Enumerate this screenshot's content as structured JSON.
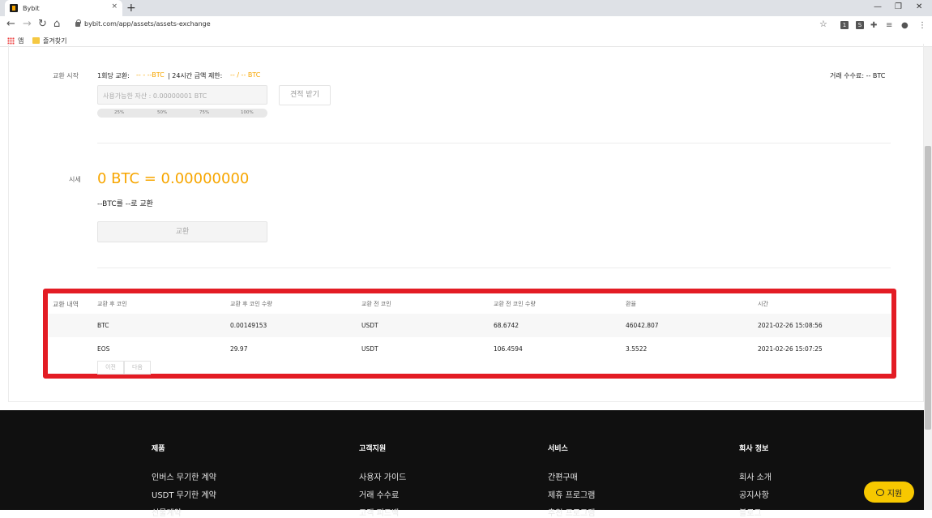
{
  "browser": {
    "tab_title": "Bybit",
    "tab_close": "×",
    "new_tab": "+",
    "url": "bybit.com/app/assets/assets-exchange",
    "bookmark_apps": "앱",
    "bookmark_folder": "즐겨찾기",
    "win_min": "—",
    "win_max": "❐",
    "win_close": "✕"
  },
  "exchange": {
    "section_label": "교환 시작",
    "per_trade_label": "1회당 교환:",
    "per_trade_value": "-- - --BTC",
    "daily_label": "| 24시간 금액 제한:",
    "daily_value": "-- / -- BTC",
    "fee_text": "거래 수수료: -- BTC",
    "input_placeholder": "사용가능한 자산 : 0.00000001 BTC",
    "quote_button": "견적 받기",
    "percents": [
      "25%",
      "50%",
      "75%",
      "100%"
    ]
  },
  "rate": {
    "label": "시세",
    "price": "0 BTC = 0.00000000",
    "pair_text": "--BTC를 --로 교환",
    "exchange_button": "교환"
  },
  "history": {
    "label": "교환 내역",
    "headers": [
      "교환 후 코인",
      "교환 후 코인 수량",
      "교환 전 코인",
      "교환 전 코인 수량",
      "환율",
      "시간"
    ],
    "rows": [
      [
        "BTC",
        "0.00149153",
        "USDT",
        "68.6742",
        "46042.807",
        "2021-02-26 15:08:56"
      ],
      [
        "EOS",
        "29.97",
        "USDT",
        "106.4594",
        "3.5522",
        "2021-02-26 15:07:25"
      ]
    ],
    "prev_button": "이전",
    "next_button": "다음"
  },
  "footer": {
    "columns": [
      {
        "title": "제품",
        "links": [
          "인버스 무기한 계약",
          "USDT 무기한 계약",
          "선물계약"
        ]
      },
      {
        "title": "고객지원",
        "links": [
          "사용자 가이드",
          "거래 수수료",
          "고객 피드백"
        ]
      },
      {
        "title": "서비스",
        "links": [
          "간편구매",
          "제휴 프로그램",
          "추천 프로그램"
        ]
      },
      {
        "title": "회사 정보",
        "links": [
          "회사 소개",
          "공지사항",
          "블로그"
        ]
      }
    ],
    "support_button": "지원"
  }
}
